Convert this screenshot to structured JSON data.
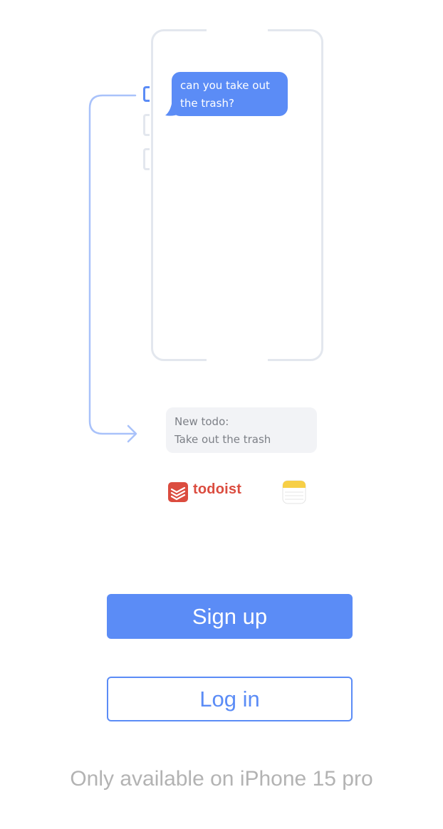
{
  "message_bubble": {
    "text": "can you take out the trash?"
  },
  "todo_card": {
    "line1": "New todo:",
    "line2": "Take out the trash"
  },
  "integrations": {
    "todoist": "todoist",
    "notes": "notes-app-icon"
  },
  "actions": {
    "signup_label": "Sign up",
    "login_label": "Log in"
  },
  "footer": {
    "note": "Only available on iPhone 15 pro"
  },
  "colors": {
    "accent": "#5b8cf6",
    "frame": "#e3e7ee",
    "card_bg": "#f2f3f6",
    "todoist": "#db4c3f",
    "footnote": "#b3b3b3"
  }
}
